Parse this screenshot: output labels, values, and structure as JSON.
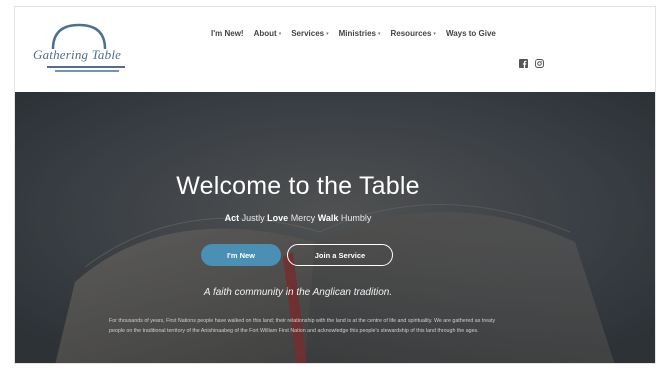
{
  "logo": {
    "text": "Gathering Table"
  },
  "nav": {
    "items": [
      {
        "label": "I'm New!",
        "caret": ""
      },
      {
        "label": "About",
        "caret": "▾"
      },
      {
        "label": "Services",
        "caret": "▾"
      },
      {
        "label": "Ministries",
        "caret": "▾"
      },
      {
        "label": "Resources",
        "caret": "▾"
      },
      {
        "label": "Ways to Give",
        "caret": ""
      }
    ]
  },
  "social": {
    "icons": [
      "facebook-icon",
      "instagram-icon"
    ]
  },
  "hero": {
    "title": "Welcome to the Table",
    "tagline": {
      "w1": "Act",
      "w2": "Justly",
      "w3": "Love",
      "w4": "Mercy",
      "w5": "Walk",
      "w6": "Humbly"
    },
    "primary_button": "I'm New",
    "secondary_button": "Join a Service",
    "subtitle": "A faith community in the Anglican tradition.",
    "land_acknowledgement": "For thousands of years, First Nations people have walked on this land; their relationship with the land is at the centre of life and spirituality. We are gathered as treaty people on the traditional territory of the Anishinaabeg of the Fort William First Nation and acknowledge this people's stewardship of this land through the ages."
  },
  "colors": {
    "accent": "#4a8fb4",
    "logo_blue": "#4e6f93",
    "hero_bg": "#3b4046"
  }
}
